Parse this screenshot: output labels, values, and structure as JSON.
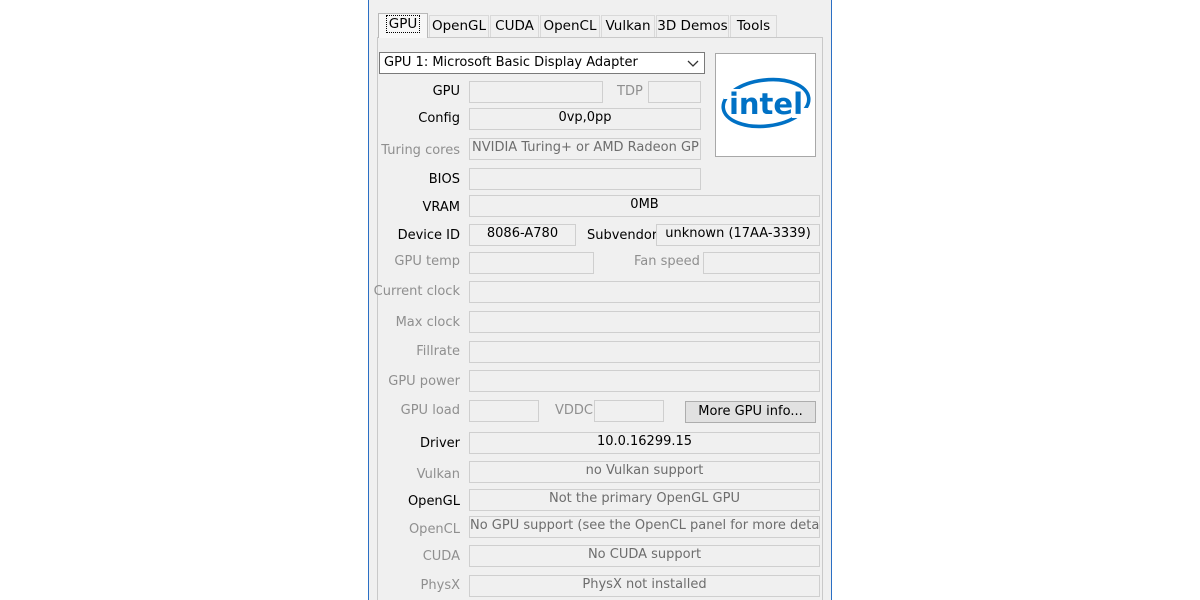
{
  "tabs": [
    "GPU",
    "OpenGL",
    "CUDA",
    "OpenCL",
    "Vulkan",
    "3D Demos",
    "Tools"
  ],
  "gpu_select": {
    "value": "GPU 1: Microsoft Basic Display Adapter"
  },
  "logo": {
    "text": "intel",
    "color": "#0071c5"
  },
  "rows": {
    "gpu": {
      "label": "GPU",
      "value": ""
    },
    "tdp": {
      "label": "TDP",
      "value": ""
    },
    "config": {
      "label": "Config",
      "value": "0vp,0pp"
    },
    "turing_cores": {
      "label": "Turing cores",
      "value": "NVIDIA Turing+ or AMD Radeon GPUs only"
    },
    "bios": {
      "label": "BIOS",
      "value": ""
    },
    "vram": {
      "label": "VRAM",
      "value": "0MB"
    },
    "device_id": {
      "label": "Device ID",
      "value": "8086-A780"
    },
    "subvendor": {
      "label": "Subvendor",
      "value": "unknown (17AA-3339)"
    },
    "gpu_temp": {
      "label": "GPU temp",
      "value": ""
    },
    "fan_speed": {
      "label": "Fan speed",
      "value": ""
    },
    "current_clock": {
      "label": "Current clock",
      "value": ""
    },
    "max_clock": {
      "label": "Max clock",
      "value": ""
    },
    "fillrate": {
      "label": "Fillrate",
      "value": ""
    },
    "gpu_power": {
      "label": "GPU power",
      "value": ""
    },
    "gpu_load": {
      "label": "GPU load",
      "value": ""
    },
    "vddc": {
      "label": "VDDC",
      "value": ""
    },
    "driver": {
      "label": "Driver",
      "value": "10.0.16299.15"
    },
    "vulkan": {
      "label": "Vulkan",
      "value": "no Vulkan support"
    },
    "opengl": {
      "label": "OpenGL",
      "value": "Not the primary OpenGL GPU"
    },
    "opencl": {
      "label": "OpenCL",
      "value": "No GPU support (see the OpenCL panel for more details)"
    },
    "cuda": {
      "label": "CUDA",
      "value": "No CUDA support"
    },
    "physx": {
      "label": "PhysX",
      "value": "PhysX not installed"
    }
  },
  "buttons": {
    "more_gpu_info": "More GPU info..."
  }
}
